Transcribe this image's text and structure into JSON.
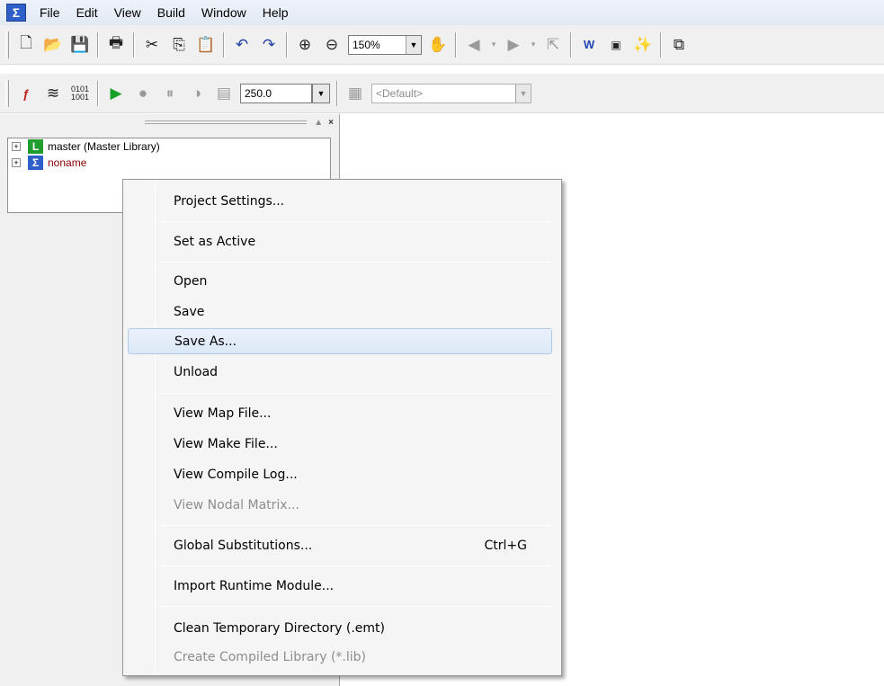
{
  "menubar": {
    "app_icon": "Σ",
    "items": [
      "File",
      "Edit",
      "View",
      "Build",
      "Window",
      "Help"
    ]
  },
  "toolbar1": {
    "zoom": "150%"
  },
  "toolbar2": {
    "speed": "250.0",
    "config": "<Default>"
  },
  "pane": {
    "close": "×",
    "tree": [
      {
        "label": "master (Master Library)",
        "icon": "L"
      },
      {
        "label": "noname",
        "icon": "Σ"
      }
    ]
  },
  "context_menu": {
    "items": [
      {
        "label": "Project Settings...",
        "shortcut": "",
        "disabled": false
      },
      {
        "label": "Set as Active",
        "shortcut": "",
        "disabled": false
      },
      {
        "label": "Open",
        "shortcut": "",
        "disabled": false
      },
      {
        "label": "Save",
        "shortcut": "",
        "disabled": false
      },
      {
        "label": "Save As...",
        "shortcut": "",
        "disabled": false
      },
      {
        "label": "Unload",
        "shortcut": "",
        "disabled": false
      },
      {
        "label": "View Map File...",
        "shortcut": "",
        "disabled": false
      },
      {
        "label": "View Make File...",
        "shortcut": "",
        "disabled": false
      },
      {
        "label": "View Compile Log...",
        "shortcut": "",
        "disabled": false
      },
      {
        "label": "View Nodal Matrix...",
        "shortcut": "",
        "disabled": true
      },
      {
        "label": "Global Substitutions...",
        "shortcut": "Ctrl+G",
        "disabled": false
      },
      {
        "label": "Import Runtime Module...",
        "shortcut": "",
        "disabled": false
      },
      {
        "label": "Clean Temporary Directory (.emt)",
        "shortcut": "",
        "disabled": false
      },
      {
        "label": "Create Compiled Library (*.lib)",
        "shortcut": "",
        "disabled": true
      }
    ]
  }
}
